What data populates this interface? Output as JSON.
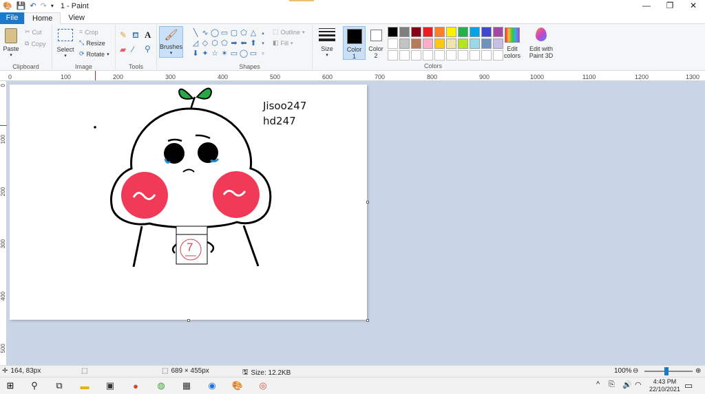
{
  "window": {
    "title": "1 - Paint"
  },
  "tabs": [
    "File",
    "Home",
    "View"
  ],
  "clipboard": {
    "paste": "Paste",
    "cut": "Cut",
    "copy": "Copy",
    "label": "Clipboard"
  },
  "image": {
    "select": "Select",
    "crop": "Crop",
    "resize": "Resize",
    "rotate": "Rotate",
    "label": "Image"
  },
  "tools": {
    "label": "Tools",
    "brushes": "Brushes"
  },
  "shapes": {
    "label": "Shapes",
    "outline": "Outline",
    "fill": "Fill",
    "glyphs": [
      "╲",
      "∿",
      "◯",
      "▭",
      "▢",
      "⬠",
      "△",
      "▵",
      "◿",
      "◇",
      "⬡",
      "⬠",
      "➡",
      "⬅",
      "⬆",
      "⬇",
      "✦",
      "☆",
      "✶",
      "▭",
      "◯",
      "▭",
      "♡",
      "⚡"
    ]
  },
  "size": {
    "label": "Size"
  },
  "color1": {
    "label": "Color",
    "num": "1",
    "value": "#000000"
  },
  "color2": {
    "label": "Color",
    "num": "2",
    "value": "#ffffff"
  },
  "colors": {
    "label": "Colors",
    "palette": [
      "#000000",
      "#7f7f7f",
      "#880015",
      "#ed1c24",
      "#ff7f27",
      "#fff200",
      "#22b14c",
      "#00a2e8",
      "#3f48cc",
      "#a349a4",
      "#ffffff",
      "#c3c3c3",
      "#b97a57",
      "#ffaec9",
      "#ffc90e",
      "#efe4b0",
      "#b5e61d",
      "#99d9ea",
      "#7092be",
      "#c8bfe7",
      "#ffffff",
      "#ffffff",
      "#ffffff",
      "#ffffff",
      "#ffffff",
      "#ffffff",
      "#ffffff",
      "#ffffff",
      "#ffffff",
      "#ffffff"
    ],
    "edit": "Edit colors",
    "paint3d": "Edit with Paint 3D"
  },
  "ruler": {
    "top": [
      "0",
      "100",
      "200",
      "300",
      "400",
      "500",
      "600",
      "700",
      "800",
      "900",
      "1000",
      "1100",
      "1200",
      "1300"
    ],
    "left": [
      "0",
      "100",
      "200",
      "300",
      "400",
      "500"
    ]
  },
  "canvas_text": {
    "line1": "Jisoo247",
    "line2": "hd247",
    "badge": "7"
  },
  "status": {
    "cursor": "164, 83px",
    "dimensions": "689 × 455px",
    "size": "Size: 12.2KB",
    "zoom": "100%"
  },
  "taskbar": {
    "time": "4:43 PM",
    "date": "22/10/2021"
  }
}
